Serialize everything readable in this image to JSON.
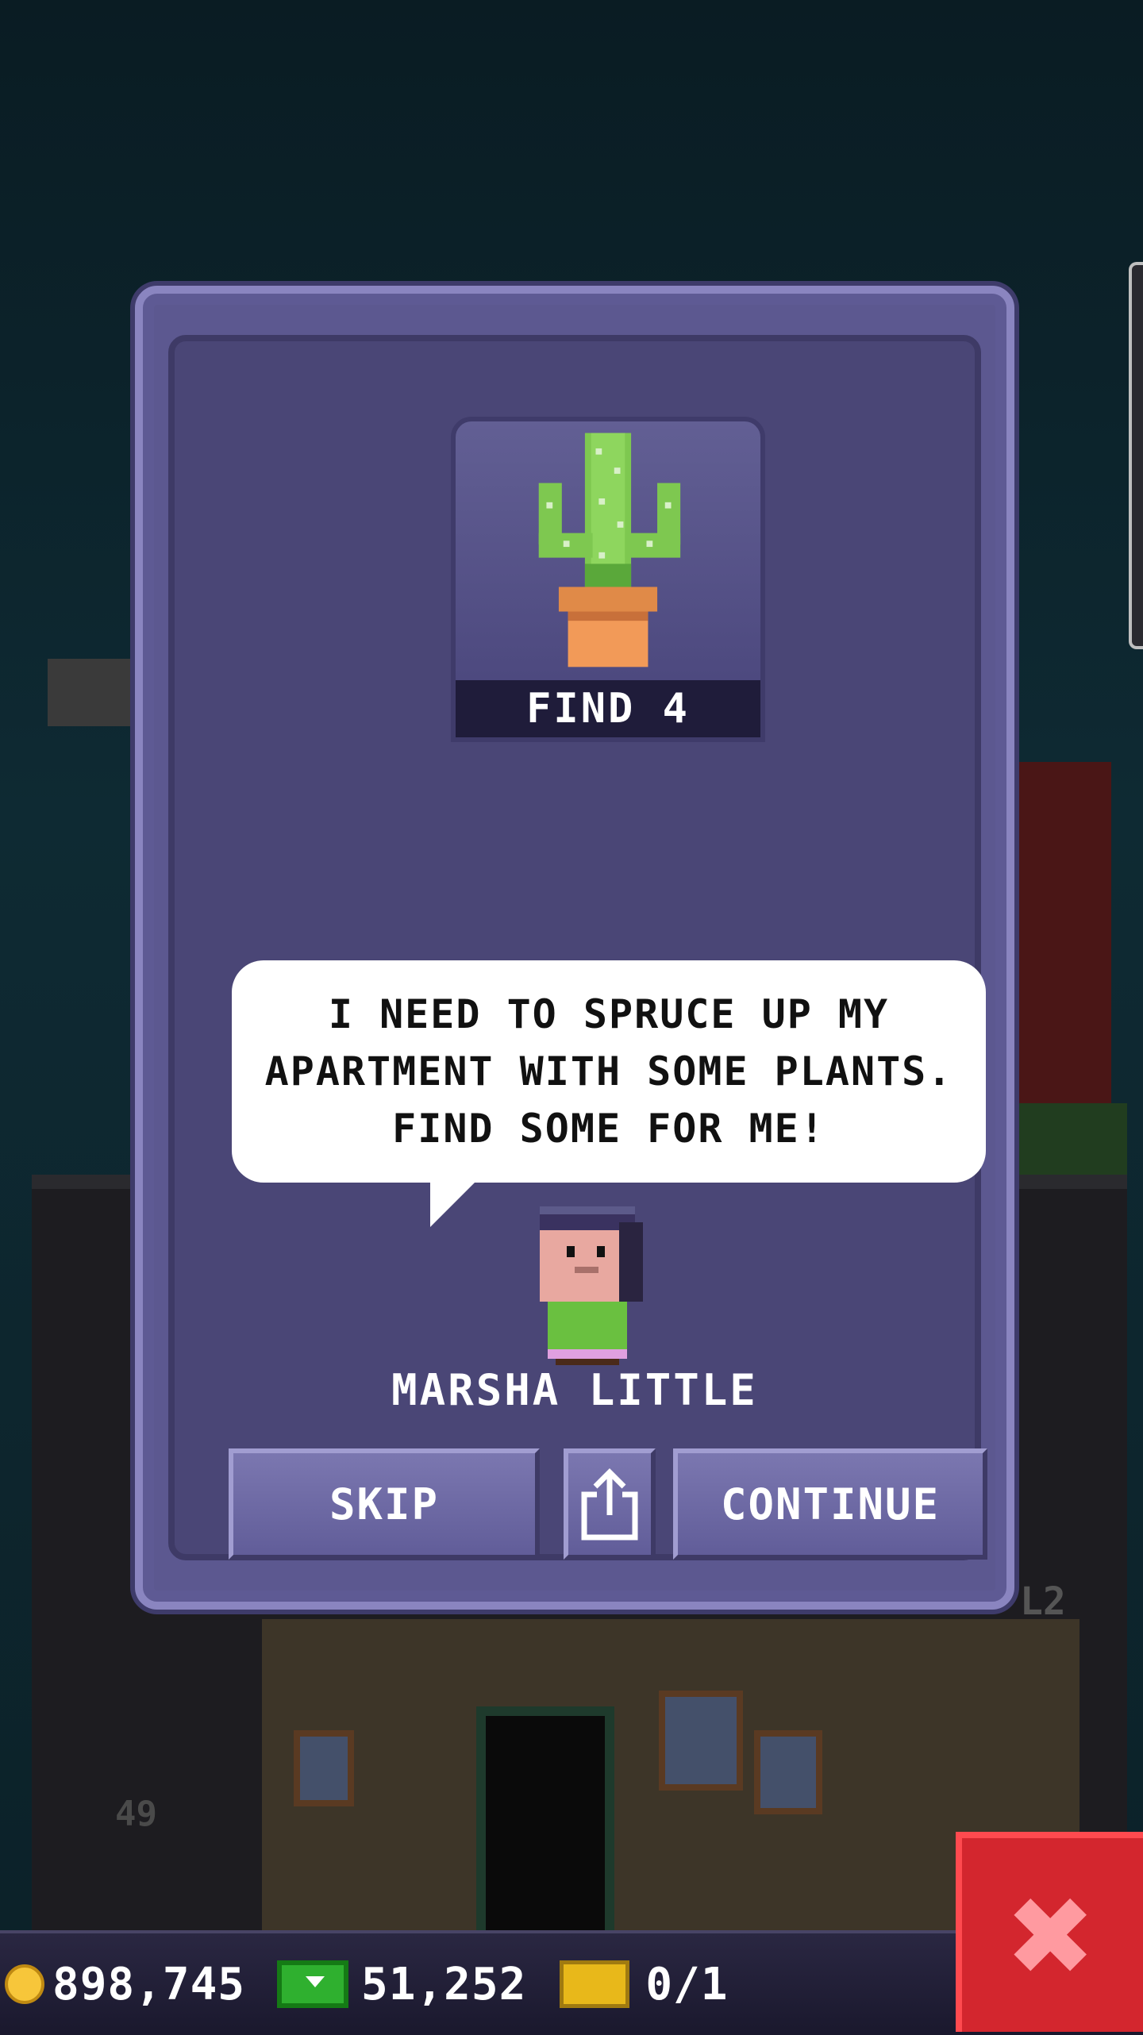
{
  "item_card": {
    "label": "FIND 4",
    "icon": "cactus-pot-icon"
  },
  "dialog": {
    "message": "I NEED TO SPRUCE UP MY APARTMENT WITH SOME PLANTS. FIND SOME FOR ME!",
    "npc_name": "MARSHA LITTLE",
    "npc_avatar": "npc-avatar"
  },
  "buttons": {
    "skip": "SKIP",
    "share_icon": "share-icon",
    "continue": "CONTINUE"
  },
  "hud": {
    "coins": "898,745",
    "bux": "51,252",
    "tickets": "0/1"
  },
  "background": {
    "floor_number": "49",
    "level_label": "L2"
  },
  "colors": {
    "modal_border": "#8a85c0",
    "modal_bg": "#4a4676",
    "close_button": "#d3262e"
  }
}
